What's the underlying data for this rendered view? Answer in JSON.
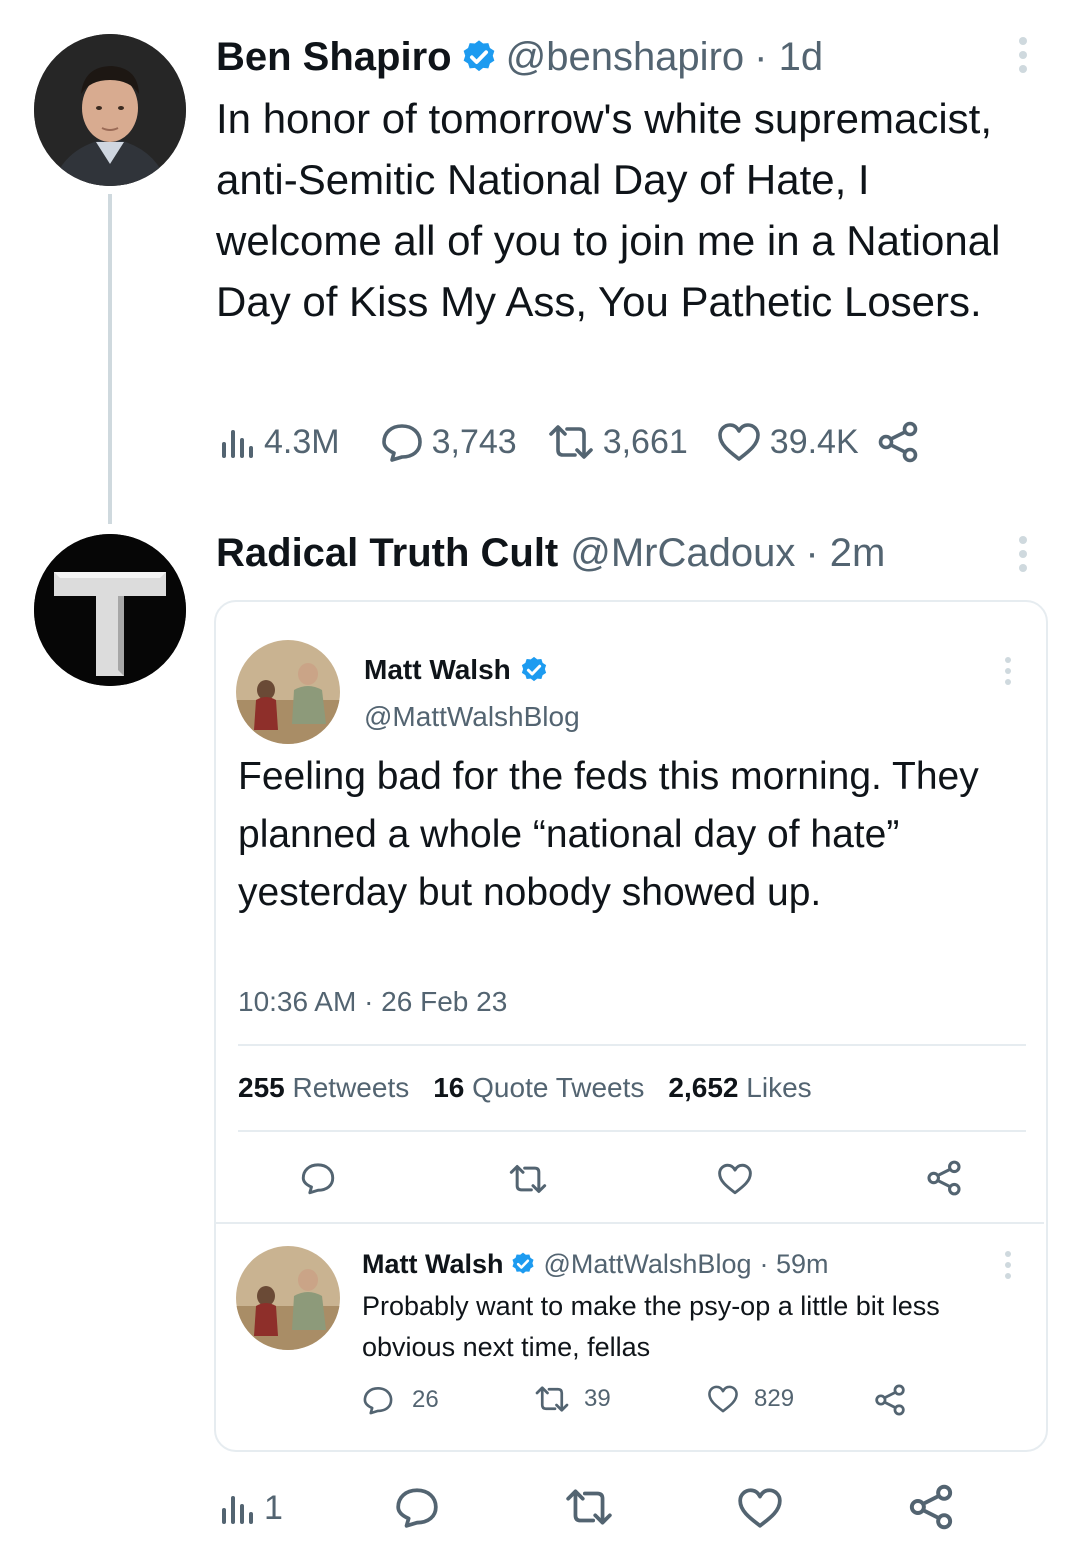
{
  "tweet1": {
    "name": "Ben Shapiro",
    "handle": "@benshapiro",
    "time": "· 1d",
    "text": "In honor of tomorrow's white supremacist, anti-Semitic National Day of Hate, I welcome all of you to join me in a National Day of Kiss My Ass, You Pathetic Losers.",
    "views": "4.3M",
    "replies": "3,743",
    "retweets": "3,661",
    "likes": "39.4K"
  },
  "tweet2": {
    "name": "Radical Truth Cult",
    "handle": "@MrCadoux",
    "time": "· 2m",
    "avatar_letter": "T",
    "views": "1"
  },
  "embed": {
    "name": "Matt Walsh",
    "handle": "@MattWalshBlog",
    "text": "Feeling bad for the feds this morning. They planned a whole “national day of hate” yesterday but nobody showed up.",
    "timestamp": "10:36 AM · 26 Feb 23",
    "retweets_count": "255",
    "retweets_label": "Retweets",
    "quotes_count": "16",
    "quotes_label": "Quote Tweets",
    "likes_count": "2,652",
    "likes_label": "Likes"
  },
  "reply": {
    "name": "Matt Walsh",
    "handle": "@MattWalshBlog",
    "time": "· 59m",
    "text": "Probably want to make the psy-op a little bit less obvious next time, fellas",
    "replies": "26",
    "retweets": "39",
    "likes": "829"
  },
  "colors": {
    "verified": "#1d9bf0",
    "text": "#0f1419",
    "muted": "#536471",
    "border": "#e6ecf0",
    "thread_line": "#cfd9de"
  },
  "icons": [
    "views-icon",
    "reply-icon",
    "retweet-icon",
    "like-icon",
    "share-icon",
    "more-icon",
    "verified-icon"
  ]
}
